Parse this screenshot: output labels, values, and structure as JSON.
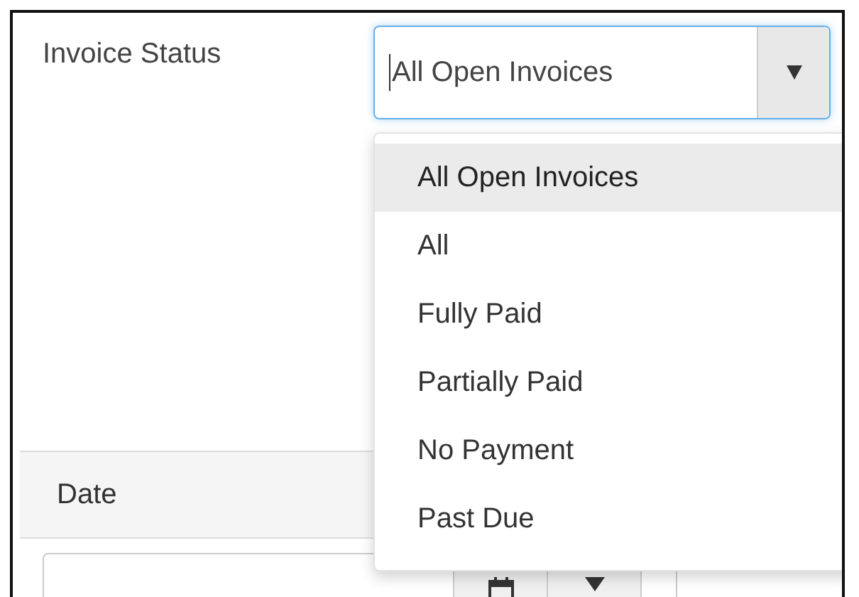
{
  "filter": {
    "label": "Invoice Status",
    "value": "All Open Invoices",
    "focused": true,
    "options": [
      {
        "label": "All Open Invoices",
        "selected": true
      },
      {
        "label": "All",
        "selected": false
      },
      {
        "label": "Fully Paid",
        "selected": false
      },
      {
        "label": "Partially Paid",
        "selected": false
      },
      {
        "label": "No Payment",
        "selected": false
      },
      {
        "label": "Past Due",
        "selected": false
      }
    ]
  },
  "table": {
    "columns": [
      {
        "label": "Date"
      }
    ]
  }
}
